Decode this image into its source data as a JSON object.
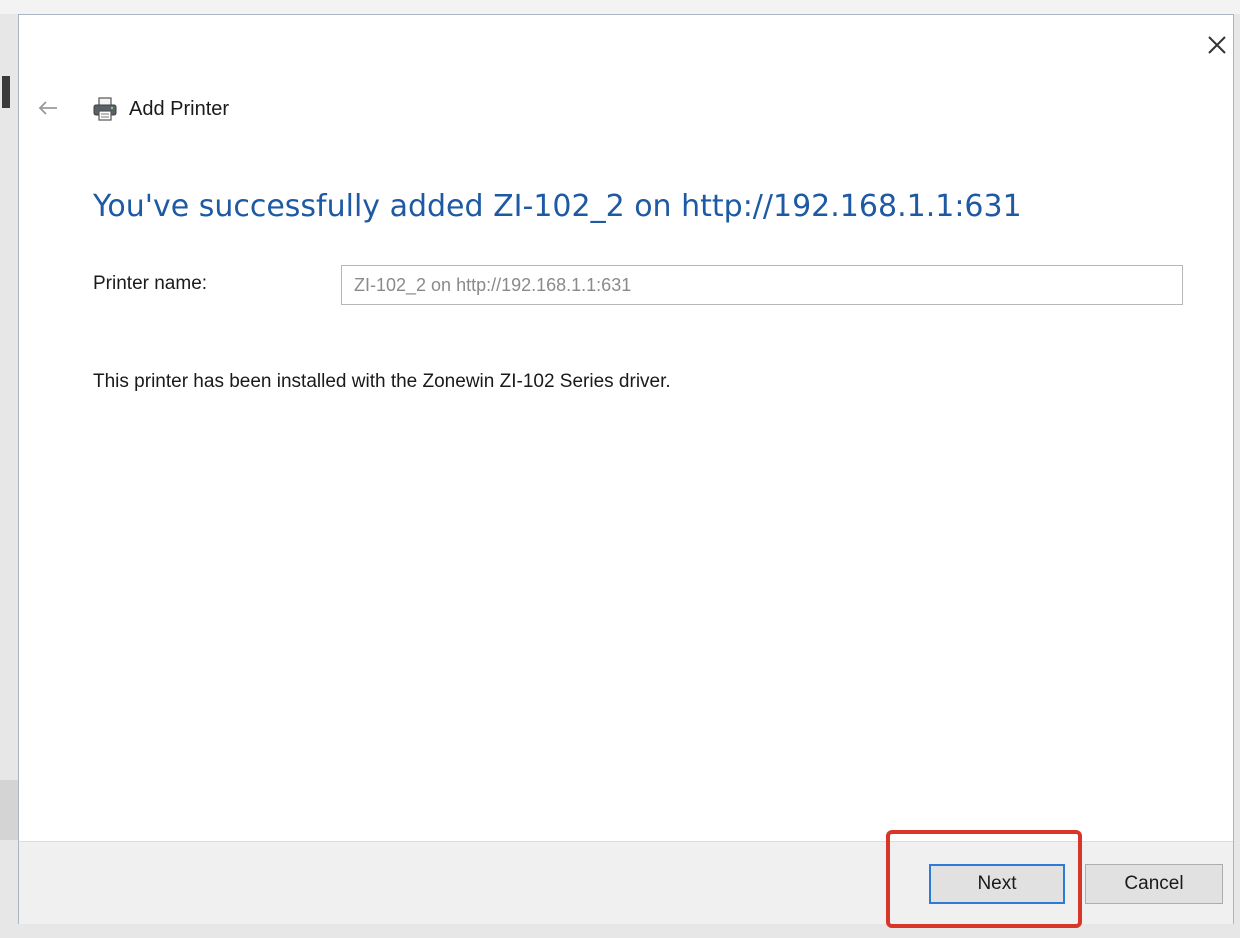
{
  "window": {
    "title": "Add Printer",
    "close_icon": "close-icon",
    "back_icon": "back-arrow-icon",
    "printer_icon": "printer-icon"
  },
  "main": {
    "heading": "You've successfully added ZI-102_2 on http://192.168.1.1:631",
    "printer_name_label": "Printer name:",
    "printer_name_value": "ZI-102_2 on http://192.168.1.1:631",
    "driver_message": "This printer has been installed with the Zonewin ZI-102 Series driver."
  },
  "footer": {
    "next_label": "Next",
    "cancel_label": "Cancel"
  },
  "colors": {
    "heading": "#1e5aa3",
    "highlight": "#d9362a",
    "focus_border": "#2f7ad4"
  }
}
